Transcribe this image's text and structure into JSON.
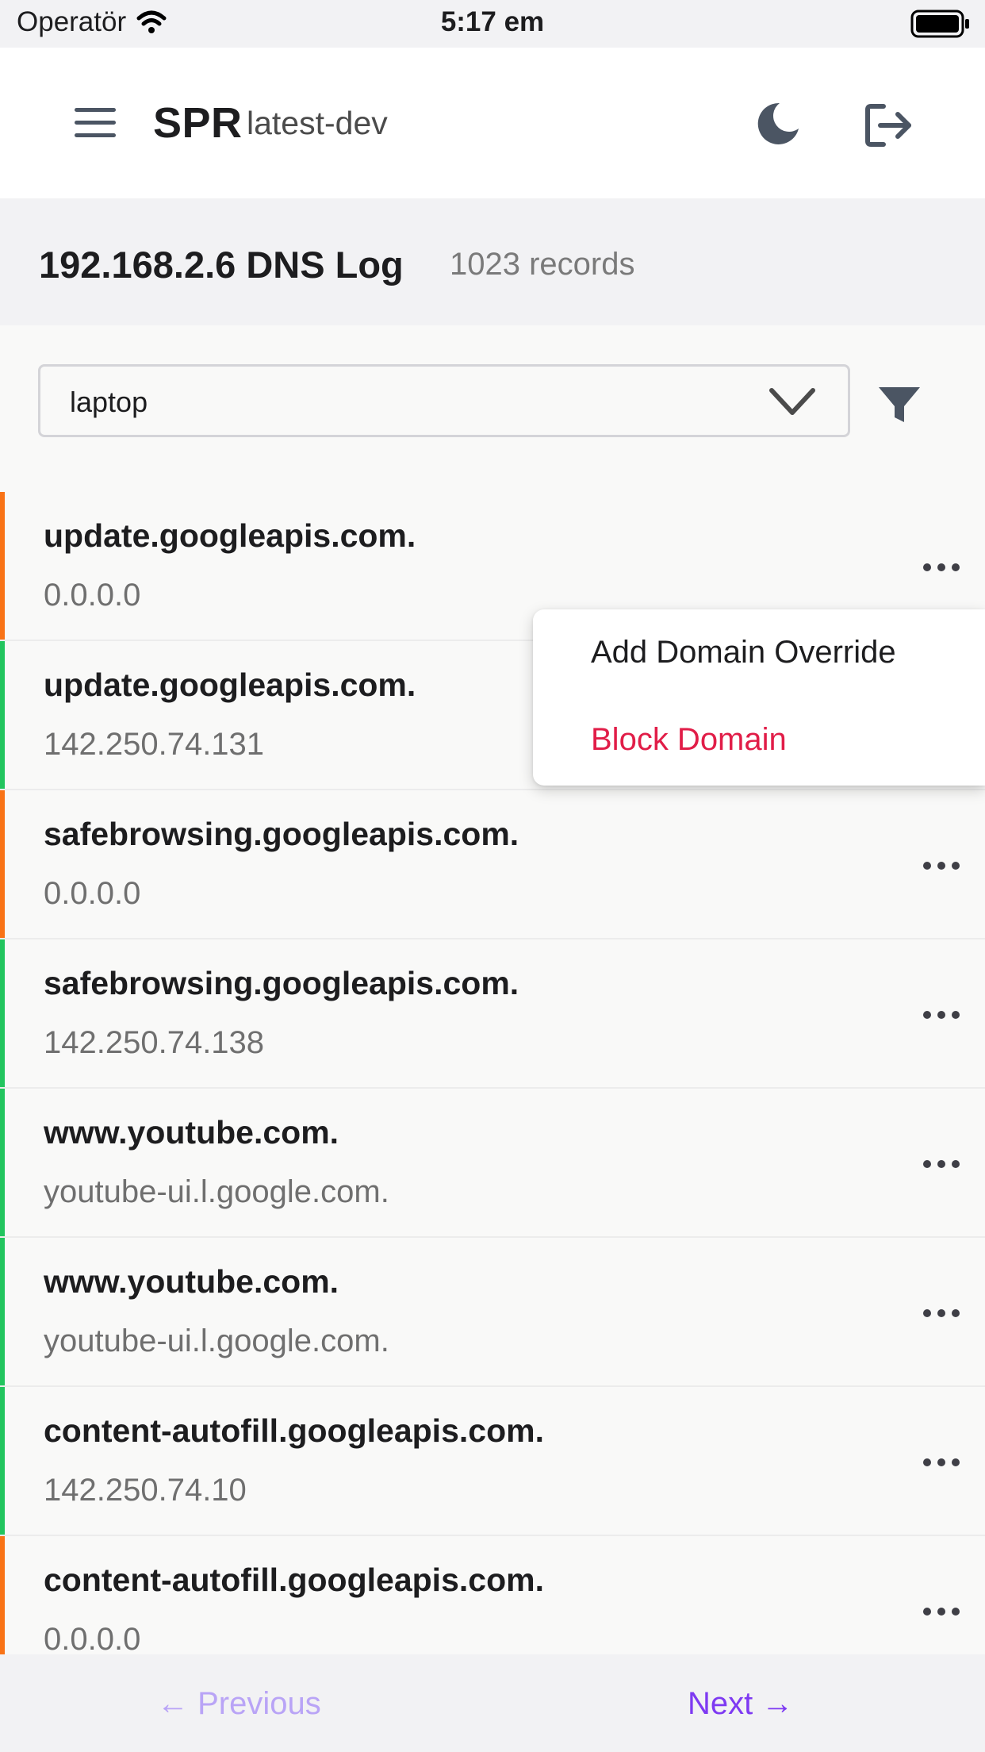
{
  "status_bar": {
    "carrier": "Operatör",
    "time": "5:17 em"
  },
  "header": {
    "brand": "SPR",
    "version": "latest-dev"
  },
  "page": {
    "title": "192.168.2.6 DNS Log",
    "record_count": "1023 records"
  },
  "filter": {
    "selected": "laptop"
  },
  "rows": [
    {
      "domain": "update.googleapis.com.",
      "answer": "0.0.0.0",
      "status_color": "#f97316"
    },
    {
      "domain": "update.googleapis.com.",
      "answer": "142.250.74.131",
      "status_color": "#22c55e"
    },
    {
      "domain": "safebrowsing.googleapis.com.",
      "answer": "0.0.0.0",
      "status_color": "#f97316"
    },
    {
      "domain": "safebrowsing.googleapis.com.",
      "answer": "142.250.74.138",
      "status_color": "#22c55e"
    },
    {
      "domain": "www.youtube.com.",
      "answer": "youtube-ui.l.google.com.",
      "status_color": "#22c55e"
    },
    {
      "domain": "www.youtube.com.",
      "answer": "youtube-ui.l.google.com.",
      "status_color": "#22c55e"
    },
    {
      "domain": "content-autofill.googleapis.com.",
      "answer": "142.250.74.10",
      "status_color": "#22c55e"
    },
    {
      "domain": "content-autofill.googleapis.com.",
      "answer": "0.0.0.0",
      "status_color": "#f97316"
    }
  ],
  "menu": {
    "add_override": "Add Domain Override",
    "block": "Block Domain"
  },
  "pagination": {
    "previous": "← Previous",
    "next": "Next →"
  },
  "colors": {
    "accent": "#7e3af2",
    "danger": "#e11d48",
    "blocked": "#f97316",
    "allowed": "#22c55e"
  }
}
